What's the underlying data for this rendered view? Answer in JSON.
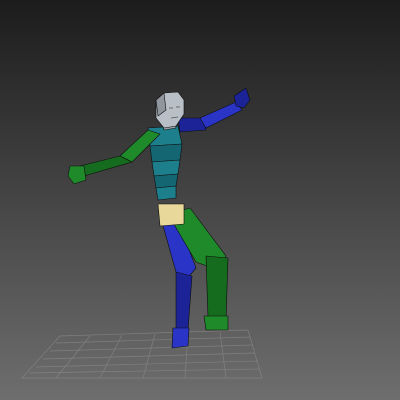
{
  "scene": {
    "background_top": "#1c1c1c",
    "background_bottom": "#6e6e6e",
    "grid_color": "#8a8a8a",
    "colors": {
      "head": "#b9bfc6",
      "torso": "#1e7f8c",
      "torso_dark": "#146772",
      "pelvis": "#e8d99a",
      "left_limb": "#2a35c8",
      "right_limb": "#1f8a2a",
      "right_limb_dark": "#156b1e",
      "left_limb_dark": "#1b2396"
    }
  }
}
